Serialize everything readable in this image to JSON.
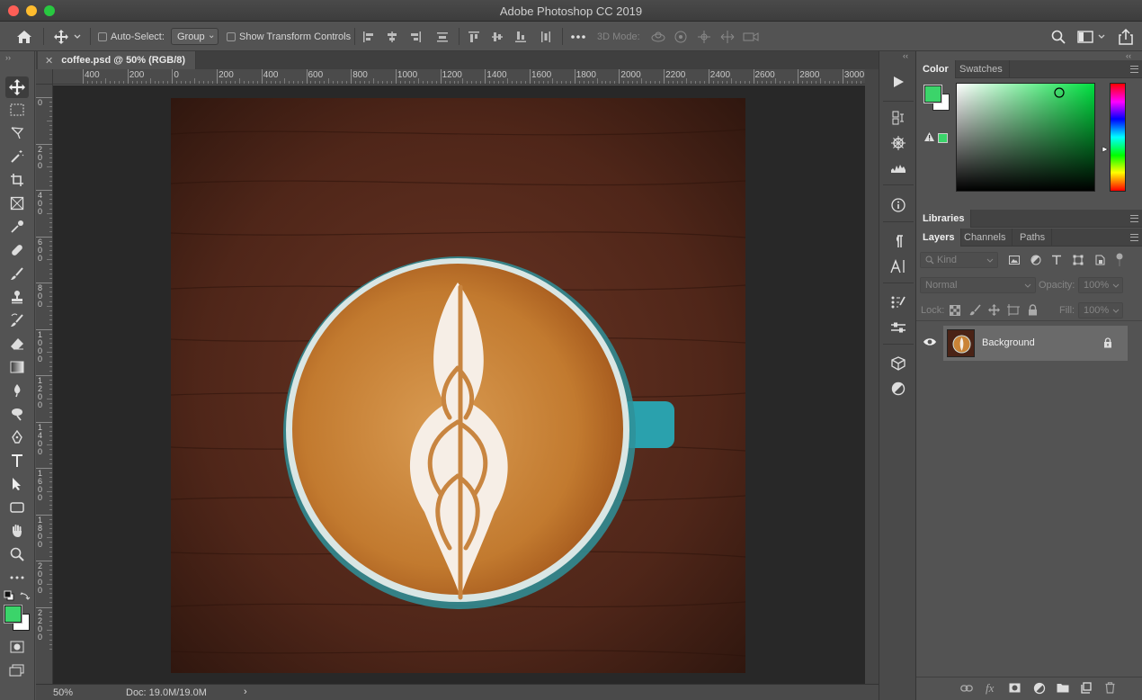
{
  "window": {
    "title": "Adobe Photoshop CC 2019"
  },
  "options_bar": {
    "auto_select_label": "Auto-Select:",
    "auto_select_value": "Group",
    "show_transform_label": "Show Transform Controls",
    "mode_3d_label": "3D Mode:"
  },
  "document": {
    "tab_title": "coffee.psd @ 50% (RGB/8)",
    "zoom": "50%",
    "doc_size": "Doc: 19.0M/19.0M",
    "ruler_h": [
      "400",
      "200",
      "0",
      "200",
      "400",
      "600",
      "800",
      "1000",
      "1200",
      "1400",
      "1600",
      "1800",
      "2000",
      "2200",
      "2400",
      "2600",
      "2800",
      "3000"
    ],
    "ruler_v": [
      "0",
      "2\n0\n0",
      "4\n0\n0",
      "6\n0\n0",
      "8\n0\n0",
      "1\n0\n0\n0",
      "1\n2\n0\n0",
      "1\n4\n0\n0",
      "1\n6\n0\n0",
      "1\n8\n0\n0",
      "2\n0\n0\n0",
      "2\n2\n0\n0"
    ]
  },
  "colors": {
    "foreground": "#3bd46a",
    "background": "#ffffff",
    "accent_blue": "#2b8bd6"
  },
  "color_panel": {
    "tab_color": "Color",
    "tab_swatches": "Swatches"
  },
  "libraries_panel": {
    "title": "Libraries"
  },
  "layers_panel": {
    "tab_layers": "Layers",
    "tab_channels": "Channels",
    "tab_paths": "Paths",
    "filter_placeholder": "Kind",
    "blend_mode": "Normal",
    "opacity_label": "Opacity:",
    "opacity_value": "100%",
    "lock_label": "Lock:",
    "fill_label": "Fill:",
    "fill_value": "100%",
    "layers": [
      {
        "name": "Background",
        "visible": true,
        "locked": true
      }
    ]
  }
}
